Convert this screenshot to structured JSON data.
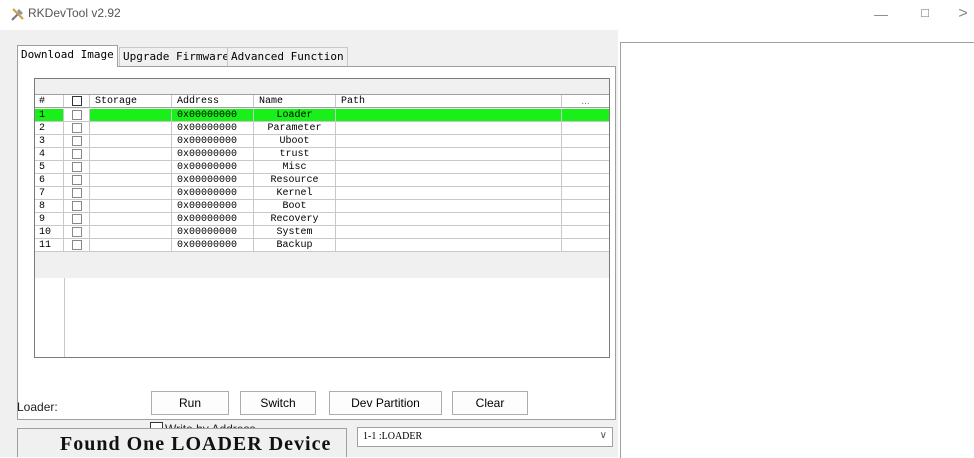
{
  "window": {
    "title": "RKDevTool v2.92",
    "minimize": "—",
    "maximize": "☐",
    "close": ">"
  },
  "tabs": [
    {
      "label": "Download Image"
    },
    {
      "label": "Upgrade Firmware"
    },
    {
      "label": "Advanced Function"
    }
  ],
  "table": {
    "headers": {
      "num": "#",
      "storage": "Storage",
      "address": "Address",
      "name": "Name",
      "path": "Path",
      "dots": "..."
    },
    "rows": [
      {
        "num": "1",
        "address": "0x00000000",
        "name": "Loader"
      },
      {
        "num": "2",
        "address": "0x00000000",
        "name": "Parameter"
      },
      {
        "num": "3",
        "address": "0x00000000",
        "name": "Uboot"
      },
      {
        "num": "4",
        "address": "0x00000000",
        "name": "trust"
      },
      {
        "num": "5",
        "address": "0x00000000",
        "name": "Misc"
      },
      {
        "num": "6",
        "address": "0x00000000",
        "name": "Resource"
      },
      {
        "num": "7",
        "address": "0x00000000",
        "name": "Kernel"
      },
      {
        "num": "8",
        "address": "0x00000000",
        "name": "Boot"
      },
      {
        "num": "9",
        "address": "0x00000000",
        "name": "Recovery"
      },
      {
        "num": "10",
        "address": "0x00000000",
        "name": "System"
      },
      {
        "num": "11",
        "address": "0x00000000",
        "name": "Backup"
      }
    ],
    "selected_row_color": "#19f019"
  },
  "controls": {
    "loader_label": "Loader:",
    "run": "Run",
    "switch": "Switch",
    "dev_partition": "Dev Partition",
    "clear": "Clear",
    "write_by_address": "Write by Address"
  },
  "status": {
    "message": "Found One LOADER Device",
    "device": "1-1 :LOADER"
  }
}
